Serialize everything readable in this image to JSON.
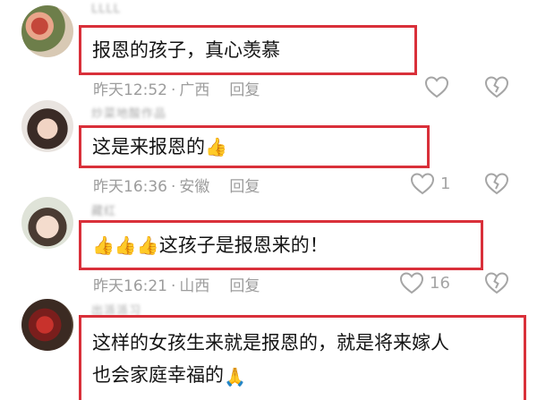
{
  "comments": [
    {
      "username": "LLLL",
      "text": "报恩的孩子，真心羡慕",
      "time": "昨天12:52",
      "location": "广西",
      "reply_label": "回复",
      "like_count": "",
      "emojis": []
    },
    {
      "username": "炒菜地酸作品",
      "text": "这是来报恩的",
      "time": "昨天16:36",
      "location": "安徽",
      "reply_label": "回复",
      "like_count": "1",
      "emojis": [
        "thumbs-up"
      ]
    },
    {
      "username": "藏红",
      "text": "这孩子是报恩来的！",
      "time": "昨天16:21",
      "location": "山西",
      "reply_label": "回复",
      "like_count": "16",
      "emojis": [
        "thumbs-up",
        "thumbs-up",
        "thumbs-up"
      ]
    },
    {
      "username": "出派派习",
      "text_line1": "这样的女孩生来就是报恩的，就是将来嫁人",
      "text_line2": "也会家庭幸福的",
      "emojis": [
        "folded-hands"
      ]
    }
  ],
  "separator": "·",
  "colors": {
    "highlight_border": "#d9303a",
    "meta_text": "#9c9c9c",
    "icon": "#a5a5a5"
  }
}
